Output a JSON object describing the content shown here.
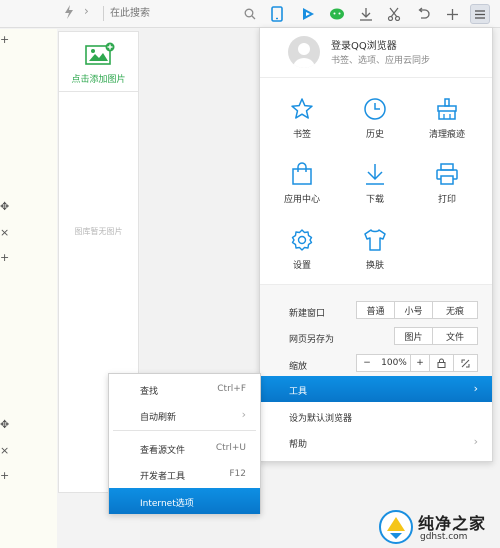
{
  "toolbar": {
    "search_placeholder": "在此搜索",
    "icons": [
      "bolt-icon",
      "chevron-right-icon",
      "search-icon",
      "phone-icon",
      "play-icon",
      "wechat-icon",
      "download-icon",
      "scissors-icon",
      "undo-icon",
      "plus-icon",
      "menu-icon"
    ]
  },
  "sidebar": {
    "glyphs": [
      "+",
      "✥",
      "×",
      "+",
      "✥",
      "×",
      "+"
    ]
  },
  "image_panel": {
    "add_label": "点击添加图片",
    "empty_text": "图库暂无图片"
  },
  "main_menu": {
    "login_title": "登录QQ浏览器",
    "login_subtitle": "书签、选项、应用云同步",
    "grid": [
      {
        "label": "书签",
        "icon": "star-icon"
      },
      {
        "label": "历史",
        "icon": "clock-icon"
      },
      {
        "label": "清理痕迹",
        "icon": "broom-icon"
      },
      {
        "label": "应用中心",
        "icon": "shopping-bag-icon"
      },
      {
        "label": "下载",
        "icon": "download-icon"
      },
      {
        "label": "打印",
        "icon": "printer-icon"
      },
      {
        "label": "设置",
        "icon": "gear-icon"
      },
      {
        "label": "换肤",
        "icon": "tshirt-icon"
      }
    ],
    "new_window": {
      "label": "新建窗口",
      "options": [
        "普通",
        "小号",
        "无痕"
      ]
    },
    "save_as": {
      "label": "网页另存为",
      "options": [
        "图片",
        "文件"
      ]
    },
    "zoom": {
      "label": "缩放",
      "minus": "−",
      "value": "100%",
      "plus": "+"
    },
    "tools": {
      "label": "工具",
      "arrow": "›"
    },
    "set_default": {
      "label": "设为默认浏览器"
    },
    "help": {
      "label": "帮助",
      "arrow": "›"
    }
  },
  "submenu": {
    "find": {
      "label": "查找",
      "shortcut": "Ctrl+F"
    },
    "auto_refresh": {
      "label": "自动刷新",
      "arrow": "›"
    },
    "view_source": {
      "label": "查看源文件",
      "shortcut": "Ctrl+U"
    },
    "devtools": {
      "label": "开发者工具",
      "shortcut": "F12"
    },
    "internet_options": {
      "label": "Internet选项"
    }
  },
  "watermark": {
    "title": "纯净之家",
    "url": "gdhst.com"
  },
  "colors": {
    "accent": "#0b84d9",
    "toolbar_blue": "#1a8fe0",
    "green": "#2fa84f"
  }
}
